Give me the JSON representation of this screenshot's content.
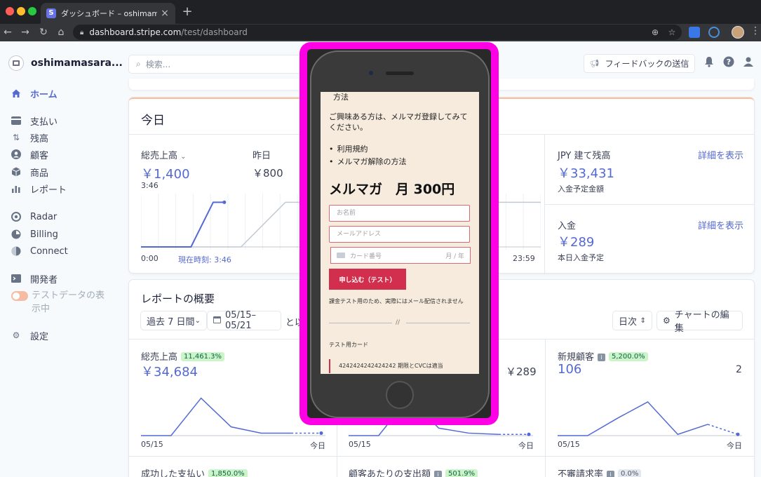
{
  "browser": {
    "tab_title": "ダッシュボード – oshimamasara",
    "favicon_letter": "S",
    "url_host": "dashboard.stripe.com",
    "url_path": "/test/dashboard"
  },
  "sidebar": {
    "account": "oshimamasara...",
    "items": [
      {
        "label": "ホーム",
        "icon": "home-icon"
      },
      {
        "label": "支払い",
        "icon": "payments-icon"
      },
      {
        "label": "残高",
        "icon": "balance-icon"
      },
      {
        "label": "顧客",
        "icon": "customer-icon"
      },
      {
        "label": "商品",
        "icon": "product-icon"
      },
      {
        "label": "レポート",
        "icon": "report-icon"
      },
      {
        "label": "Radar",
        "icon": "radar-icon"
      },
      {
        "label": "Billing",
        "icon": "billing-icon"
      },
      {
        "label": "Connect",
        "icon": "connect-icon"
      },
      {
        "label": "開発者",
        "icon": "developer-icon"
      },
      {
        "label": "設定",
        "icon": "gear-icon"
      }
    ],
    "test_data_label": "テストデータの表示中"
  },
  "header": {
    "search_placeholder": "検索...",
    "feedback_label": "フィードバックの送信"
  },
  "today": {
    "title": "今日",
    "gross_label": "総売上高",
    "gross_value": "￥1,400",
    "gross_time": "3:46",
    "yesterday_label": "昨日",
    "yesterday_value": "￥800",
    "axis_start": "0:00",
    "axis_now": "現在時刻: 3:46",
    "axis_end": "23:59",
    "balance_label": "JPY 建て残高",
    "balance_value": "￥33,431",
    "balance_sub": "入金予定金額",
    "detail_link": "詳細を表示",
    "payout_label": "入金",
    "payout_value": "￥289",
    "payout_sub": "本日入金予定",
    "chart": {
      "today": [
        [
          0,
          0
        ],
        [
          180,
          0
        ],
        [
          260,
          2
        ],
        [
          300,
          2
        ]
      ],
      "yesterday": [
        [
          0,
          0
        ],
        [
          360,
          0
        ],
        [
          520,
          2
        ],
        [
          1439,
          2
        ]
      ]
    }
  },
  "report": {
    "title": "レポートの概要",
    "range_select": "過去 7 日間",
    "date_range": "05/15–05/21",
    "compare_prefix": "と以",
    "interval": "日次",
    "edit_chart": "チャートの編集",
    "metrics": [
      {
        "label": "総売上高",
        "change": "11,461.3%",
        "value": "￥34,684",
        "start": "05/15",
        "end": "今日"
      },
      {
        "label": "",
        "change": "",
        "value": "￥289",
        "start": "05/15",
        "end": "今日"
      },
      {
        "label": "新規顧客",
        "change": "5,200.0%",
        "value": "106",
        "compare": "2",
        "start": "05/15",
        "end": "今日"
      }
    ],
    "bottom_labels": [
      {
        "label": "成功した支払い",
        "change": "1,850.0%"
      },
      {
        "label": "顧客あたりの支出額",
        "change": "501.9%"
      },
      {
        "label": "不審請求率",
        "change": "0.0%"
      }
    ],
    "chart_data": [
      {
        "type": "line",
        "x": [
          "05/15",
          "05/16",
          "05/17",
          "05/18",
          "05/19",
          "05/20",
          "05/21"
        ],
        "series": [
          {
            "values": [
              0,
              0,
              3,
              0.7,
              0.2,
              0.2,
              0.2
            ]
          }
        ]
      },
      {
        "type": "line",
        "x": [
          "05/15",
          "05/16",
          "05/17",
          "05/18",
          "05/19",
          "05/20",
          "05/21"
        ],
        "series": [
          {
            "values": [
              0,
              0,
              3,
              0.6,
              0.2,
              0.1,
              0.1
            ]
          }
        ]
      },
      {
        "type": "line",
        "x": [
          "05/15",
          "05/16",
          "05/17",
          "05/18",
          "05/19",
          "05/20",
          "05/21"
        ],
        "series": [
          {
            "values": [
              0,
              0,
              1.4,
              2.7,
              0.1,
              0.9,
              0.1
            ]
          }
        ]
      }
    ]
  },
  "phone": {
    "line1": "方法",
    "line2": "ご興味ある方は、メルマガ登録してみてください。",
    "bullets": [
      "利用規約",
      "メルマガ解除の方法"
    ],
    "heading": "メルマガ　月 300円",
    "name_placeholder": "お名前",
    "email_placeholder": "メールアドレス",
    "card_placeholder": "カード番号",
    "card_expiry": "月 / 年",
    "subscribe_label": "申し込む（テスト）",
    "note": "課金テスト用のため、実際にはメール配信されません",
    "divider": "//",
    "testcard_label": "テスト用カード",
    "testcard_number": "4242424242424242 期限とCVCは適当"
  },
  "colors": {
    "accent": "#5469d4",
    "frame": "#ff00e6",
    "button": "#d12f4d"
  }
}
